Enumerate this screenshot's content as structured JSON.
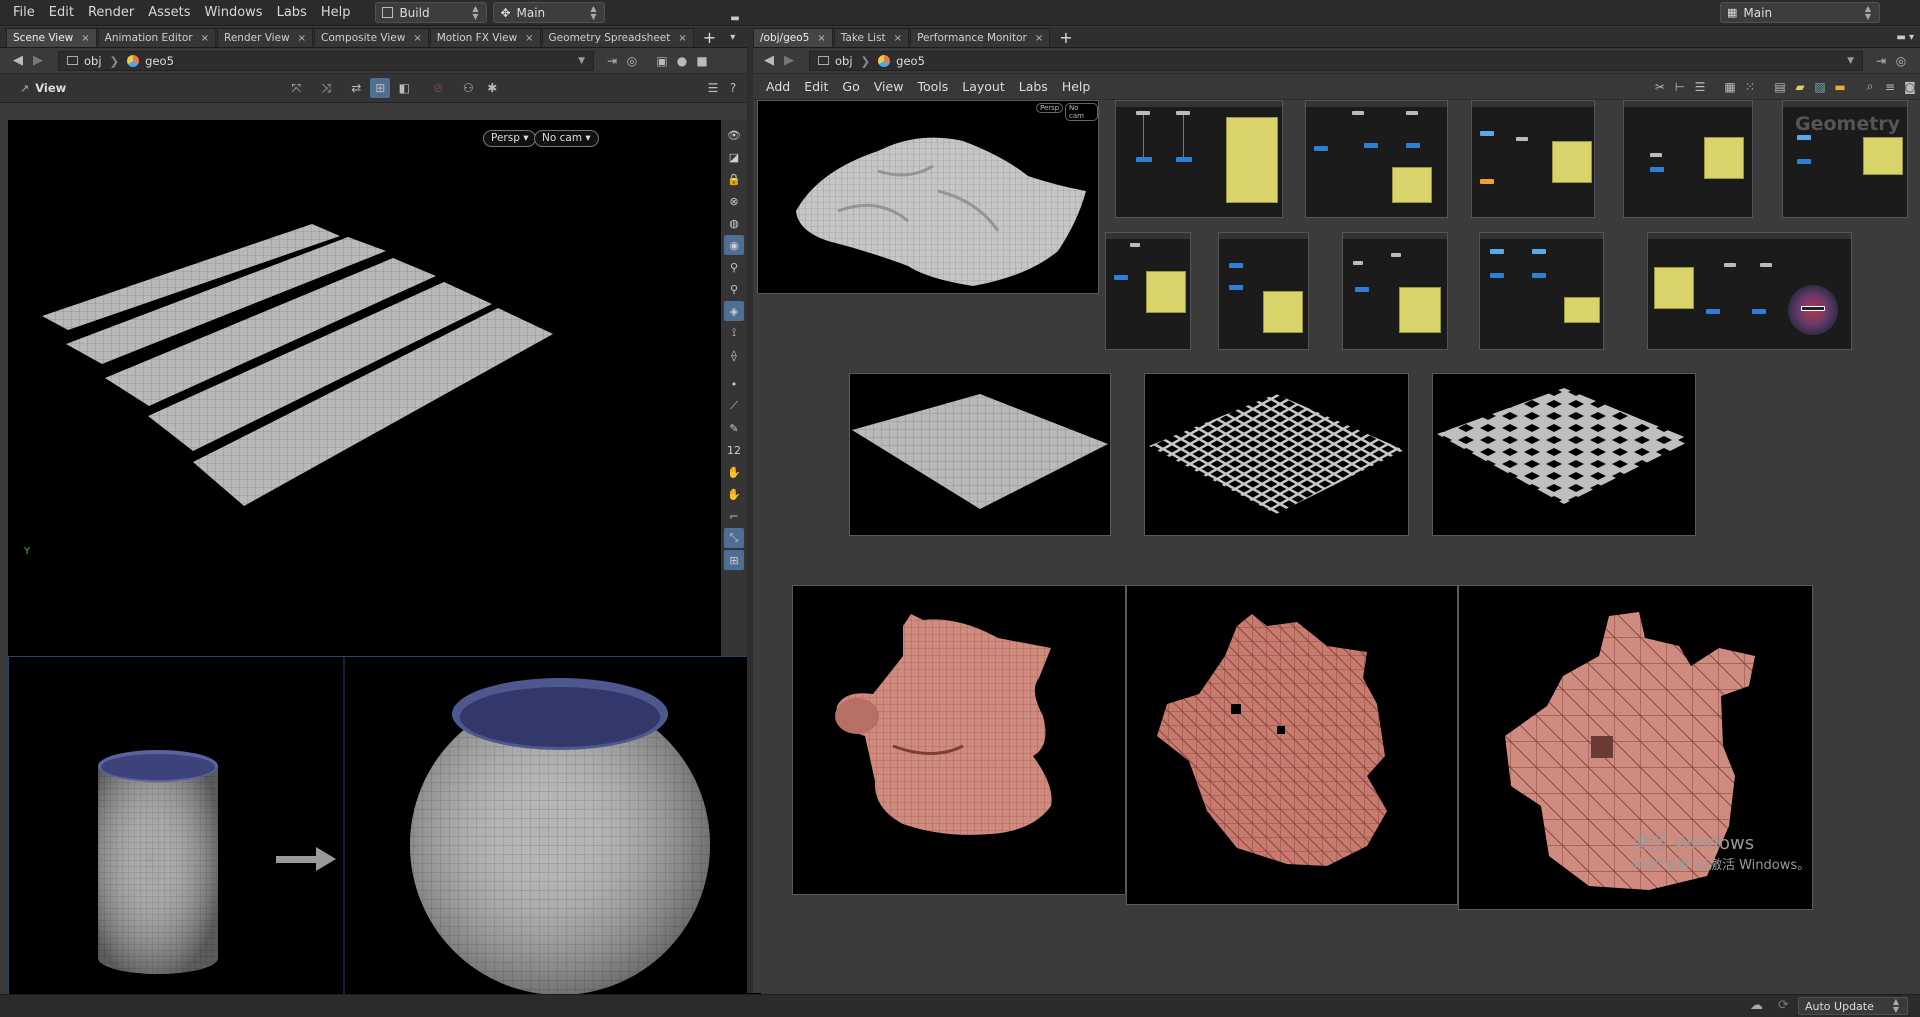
{
  "menubar": {
    "items": [
      "File",
      "Edit",
      "Render",
      "Assets",
      "Windows",
      "Labs",
      "Help"
    ],
    "desktop_value": "Build",
    "runlevel_value": "Main",
    "workspace_value": "Main"
  },
  "left_pane": {
    "tabs": [
      {
        "label": "Scene View",
        "active": true
      },
      {
        "label": "Animation Editor",
        "active": false
      },
      {
        "label": "Render View",
        "active": false
      },
      {
        "label": "Composite View",
        "active": false
      },
      {
        "label": "Motion FX View",
        "active": false
      },
      {
        "label": "Geometry Spreadsheet",
        "active": false
      }
    ],
    "path": {
      "root": "obj",
      "node": "geo5"
    },
    "view_label": "View",
    "persp_button": "Persp",
    "cam_button": "No cam",
    "axis_label": "Y"
  },
  "right_pane": {
    "tabs": [
      {
        "label": "/obj/geo5",
        "active": true
      },
      {
        "label": "Take List",
        "active": false
      },
      {
        "label": "Performance Monitor",
        "active": false
      }
    ],
    "path": {
      "root": "obj",
      "node": "geo5"
    },
    "menu": [
      "Add",
      "Edit",
      "Go",
      "View",
      "Tools",
      "Layout",
      "Labs",
      "Help"
    ],
    "thumb_persp": "Persp",
    "thumb_cam": "No cam",
    "geometry_watermark": "Geometry"
  },
  "watermark": {
    "line1": "激活 Windows",
    "line2": "转到\"设置\"以激活 Windows。"
  },
  "statusbar": {
    "auto_update": "Auto Update"
  },
  "colors": {
    "accent_blue": "#2e7fd9",
    "note_yellow": "#d9d46a",
    "skin": "#c97a6e",
    "selection_blue": "#4e6e93"
  }
}
